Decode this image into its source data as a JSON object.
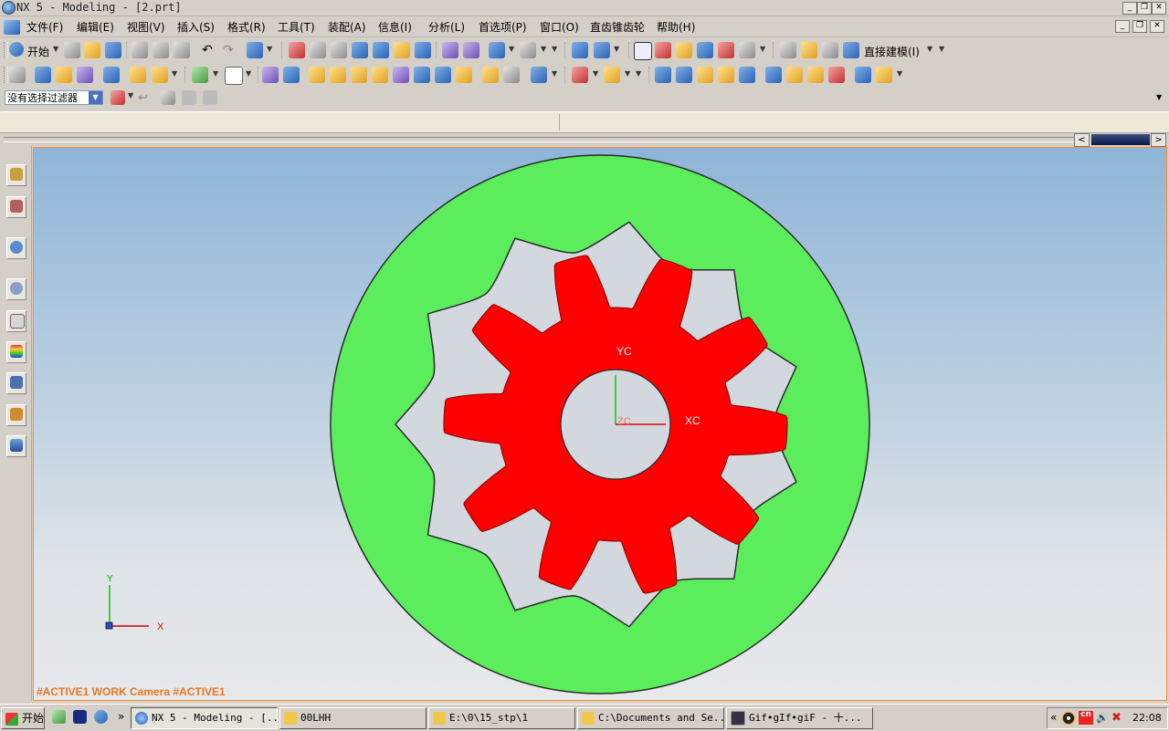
{
  "window": {
    "title": "NX 5 - Modeling - [2.prt]",
    "minimize": "_",
    "restore": "❐",
    "close": "✕"
  },
  "menu": {
    "items": [
      "文件(F)",
      "编辑(E)",
      "视图(V)",
      "插入(S)",
      "格式(R)",
      "工具(T)",
      "装配(A)",
      "信息(I)",
      "分析(L)",
      "首选项(P)",
      "窗口(O)",
      "直齿锥齿轮",
      "帮助(H)"
    ]
  },
  "toolbar": {
    "start_label": "开始",
    "direct_modeling_label": "直接建模(I)"
  },
  "filter": {
    "value": "没有选择过滤器"
  },
  "viewport": {
    "status_text": "#ACTIVE1 WORK Camera #ACTIVE1",
    "wcs_labels": {
      "x": "XC",
      "y": "YC",
      "z": "ZC"
    },
    "abs_labels": {
      "x": "X",
      "y": "Y"
    },
    "colors": {
      "ring": "#5ced5c",
      "gear": "#ff0000",
      "outline": "#2a2a2a",
      "status": "#e87722"
    }
  },
  "taskbar": {
    "start_label": "开始",
    "more": "»",
    "tasks": [
      {
        "label": "NX 5 - Modeling - [..."
      },
      {
        "label": "00LHH"
      },
      {
        "label": "E:\\0\\15_stp\\1"
      },
      {
        "label": "C:\\Documents and Se..."
      },
      {
        "label": "Gif•gIf•giF - 十..."
      }
    ],
    "tray_more": "«",
    "clock": "22:08"
  }
}
